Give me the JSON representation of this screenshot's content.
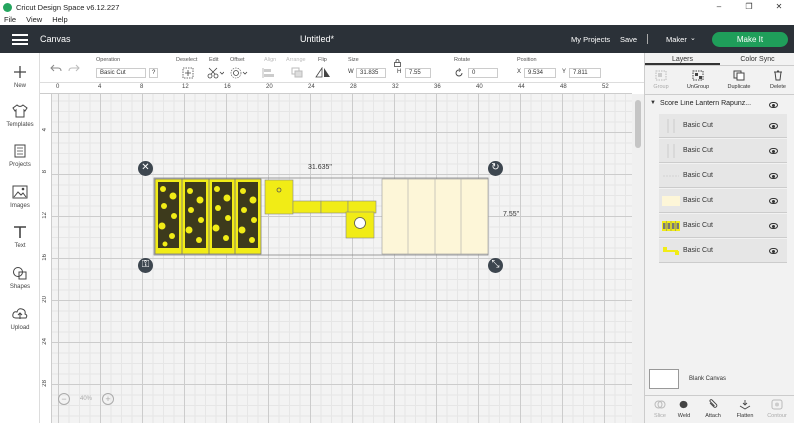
{
  "app": {
    "title": "Cricut Design Space  v6.12.227"
  },
  "menu": [
    "File",
    "View",
    "Help"
  ],
  "header": {
    "section": "Canvas",
    "document_title": "Untitled*",
    "my_projects": "My Projects",
    "save": "Save",
    "machine": "Maker",
    "make_it": "Make It"
  },
  "sidebar": [
    {
      "label": "New",
      "icon": "plus-icon"
    },
    {
      "label": "Templates",
      "icon": "shirt-icon"
    },
    {
      "label": "Projects",
      "icon": "projects-icon"
    },
    {
      "label": "Images",
      "icon": "images-icon"
    },
    {
      "label": "Text",
      "icon": "text-icon"
    },
    {
      "label": "Shapes",
      "icon": "shapes-icon"
    },
    {
      "label": "Upload",
      "icon": "upload-icon"
    }
  ],
  "toolbar": {
    "operation_label": "Operation",
    "operation_value": "Basic Cut",
    "help": "?",
    "deselect": "Deselect",
    "edit": "Edit",
    "offset": "Offset",
    "align": "Align",
    "arrange": "Arrange",
    "flip": "Flip",
    "size_label": "Size",
    "w_prefix": "W",
    "w_value": "31.835",
    "h_prefix": "H",
    "h_value": "7.55",
    "rotate_label": "Rotate",
    "rotate_value": "0",
    "position_label": "Position",
    "x_prefix": "X",
    "x_value": "9.534",
    "y_prefix": "Y",
    "y_value": "7.811"
  },
  "rulers": {
    "top": [
      "0",
      "4",
      "8",
      "12",
      "16",
      "20",
      "24",
      "28",
      "32",
      "36",
      "40",
      "44",
      "48",
      "52"
    ],
    "left": [
      "4",
      "8",
      "12",
      "16",
      "20",
      "24",
      "28"
    ]
  },
  "canvas": {
    "width_label": "31.635\"",
    "height_label": "7.55\"",
    "zoom": "40%"
  },
  "colors": {
    "header": "#2b3138",
    "accent": "#1f9e5a",
    "cut_yellow": "#f1ec16",
    "score_cream": "#fdf6d8"
  },
  "panel": {
    "tabs": [
      "Layers",
      "Color Sync"
    ],
    "tools": [
      {
        "label": "Group",
        "enabled": false
      },
      {
        "label": "UnGroup",
        "enabled": true
      },
      {
        "label": "Duplicate",
        "enabled": true
      },
      {
        "label": "Delete",
        "enabled": true
      }
    ],
    "group_name": "Score Line Lantern Rapunz...",
    "layers": [
      {
        "name": "Basic Cut",
        "thumb": "lines"
      },
      {
        "name": "Basic Cut",
        "thumb": "lines"
      },
      {
        "name": "Basic Cut",
        "thumb": "dash"
      },
      {
        "name": "Basic Cut",
        "thumb": "cream"
      },
      {
        "name": "Basic Cut",
        "thumb": "panels"
      },
      {
        "name": "Basic Cut",
        "thumb": "strip"
      }
    ],
    "blank_canvas": "Blank Canvas",
    "bottom_tools": [
      {
        "label": "Slice",
        "enabled": false
      },
      {
        "label": "Weld",
        "enabled": true
      },
      {
        "label": "Attach",
        "enabled": true
      },
      {
        "label": "Flatten",
        "enabled": true
      },
      {
        "label": "Contour",
        "enabled": false
      }
    ]
  }
}
